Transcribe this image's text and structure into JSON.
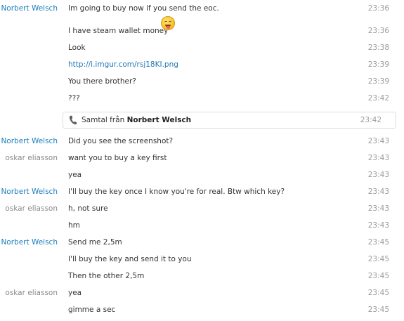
{
  "messages_top": [
    {
      "sender": "Norbert Welsch",
      "text": "Im going to buy now if you send the eoc.",
      "time": "23:36"
    },
    {
      "sender": "",
      "text": "I have steam wallet money",
      "time": "23:36"
    },
    {
      "sender": "",
      "text": "Look",
      "time": "23:38"
    },
    {
      "sender": "",
      "text": "http://i.imgur.com/rsj18KI.png",
      "time": "23:39"
    },
    {
      "sender": "",
      "text": "You there brother?",
      "time": "23:39"
    },
    {
      "sender": "",
      "text": "???",
      "time": "23:42"
    }
  ],
  "call": {
    "prefix": "Samtal från",
    "name": "Norbert Welsch",
    "time": "23:42"
  },
  "messages_bottom": [
    {
      "sender": "Norbert Welsch",
      "text": "Did you see the screenshot?",
      "time": "23:43"
    },
    {
      "sender": "oskar eliasson",
      "text": "want you to buy a key first",
      "time": "23:43"
    },
    {
      "sender": "",
      "text": "yea",
      "time": "23:43"
    },
    {
      "sender": "Norbert Welsch",
      "text": "I'll buy the key once I know you're for real. Btw which key?",
      "time": "23:43"
    },
    {
      "sender": "oskar eliasson",
      "text": "h, not sure",
      "time": "23:43"
    },
    {
      "sender": "",
      "text": "hm",
      "time": "23:43"
    },
    {
      "sender": "Norbert Welsch",
      "text": "Send me 2,5m",
      "time": "23:45"
    },
    {
      "sender": "",
      "text": "I'll buy the key and send it to you",
      "time": "23:45"
    },
    {
      "sender": "",
      "text": "Then the other 2,5m",
      "time": "23:45"
    },
    {
      "sender": "oskar eliasson",
      "text": "yea",
      "time": "23:45"
    },
    {
      "sender": "",
      "text": "gimme a sec",
      "time": "23:45"
    }
  ],
  "icons": {
    "emoji": "tongue-out-smiley-icon",
    "call": "phone-icon"
  },
  "colors": {
    "norbert": "#1d7fba",
    "oskar": "#8a8a8a",
    "link": "#1f78b4",
    "time": "#9a9a9a"
  }
}
